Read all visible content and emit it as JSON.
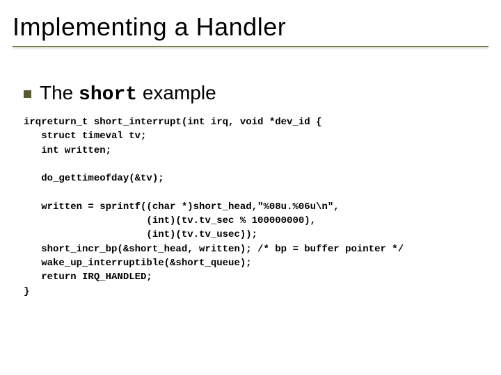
{
  "title": "Implementing a Handler",
  "bullet": {
    "prefix": "The ",
    "mono": "short",
    "suffix": " example"
  },
  "code": "irqreturn_t short_interrupt(int irq, void *dev_id {\n   struct timeval tv;\n   int written;\n\n   do_gettimeofday(&tv);\n\n   written = sprintf((char *)short_head,\"%08u.%06u\\n\",\n                     (int)(tv.tv_sec % 100000000),\n                     (int)(tv.tv_usec));\n   short_incr_bp(&short_head, written); /* bp = buffer pointer */\n   wake_up_interruptible(&short_queue);\n   return IRQ_HANDLED;\n}"
}
